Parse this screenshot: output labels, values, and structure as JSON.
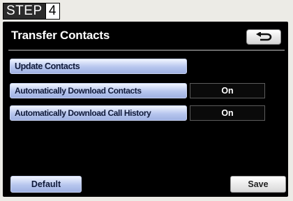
{
  "step": {
    "label": "STEP",
    "number": "4"
  },
  "screen": {
    "title": "Transfer Contacts",
    "back_icon": "return-arrow-icon",
    "update_contacts_label": "Update Contacts",
    "settings": [
      {
        "label": "Automatically Download Contacts",
        "value": "On"
      },
      {
        "label": "Automatically Download Call History",
        "value": "On"
      }
    ],
    "default_label": "Default",
    "save_label": "Save"
  },
  "colors": {
    "screen_background": "#000000",
    "button_blue": "#b7c6ee",
    "button_white": "#ffffff"
  }
}
